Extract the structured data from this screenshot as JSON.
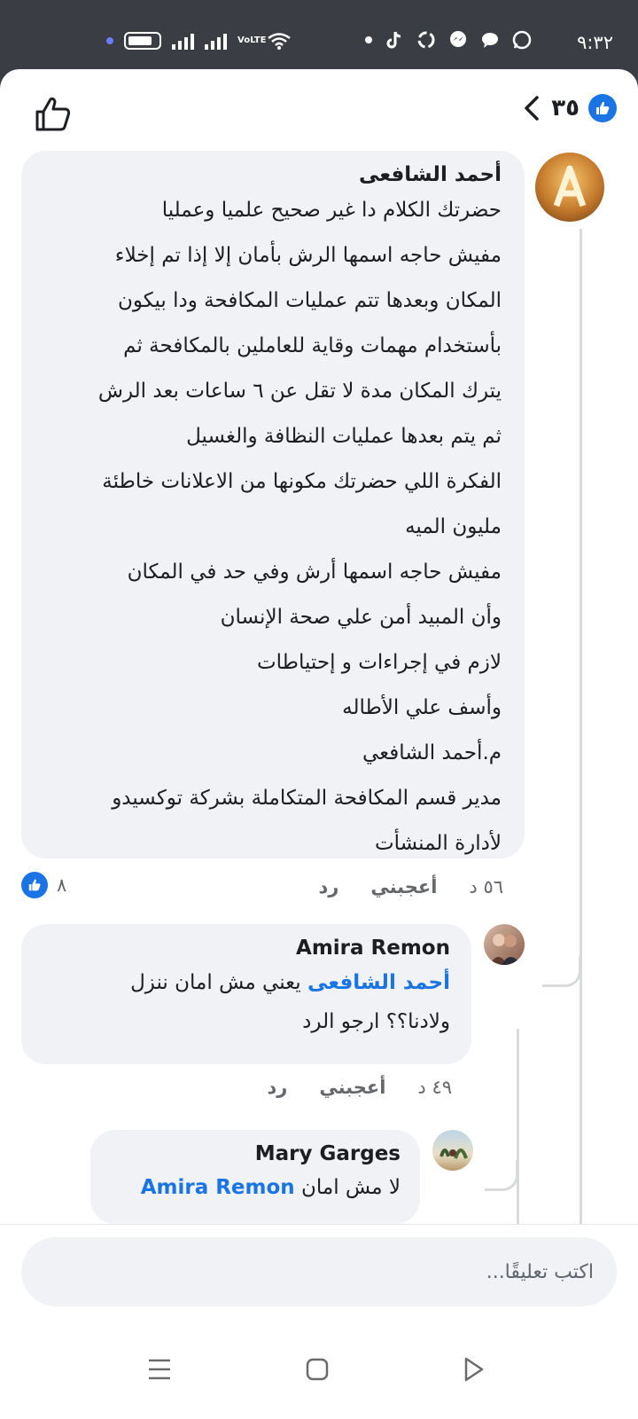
{
  "status": {
    "time": "٩:٣٢",
    "network": "VoLTE"
  },
  "header": {
    "reaction_count": "٣٥"
  },
  "comments": [
    {
      "author": "أحمد الشافعى",
      "text": "حضرتك الكلام دا غير صحيح علميا وعمليا\nمفيش حاجه اسمها الرش بأمان إلا إذا تم إخلاء\nالمكان وبعدها تتم عمليات المكافحة ودا بيكون\nبأستخدام مهمات وقاية للعاملين بالمكافحة ثم\nيترك المكان مدة لا تقل عن ٦ ساعات بعد الرش\nثم يتم بعدها عمليات النظافة والغسيل\nالفكرة اللي حضرتك مكونها من الاعلانات خاطئة\nمليون الميه\nمفيش حاجه اسمها أرش وفي حد في المكان\nوأن المبيد أمن علي صحة الإنسان\nلازم في إجراءات و إحتياطات\nوأسف علي الأطاله\nم.أحمد الشافعي\nمدير قسم المكافحة المتكاملة بشركة توكسيدو\nلأدارة المنشأت",
      "time": "٥٦ د",
      "like_label": "أعجبني",
      "reply_label": "رد",
      "likes": "٨"
    },
    {
      "author": "Amira Remon",
      "mention": "أحمد الشافعى",
      "text_line1": " يعني مش امان ننزل",
      "text_line2": "ولادنا؟؟ ارجو الرد",
      "time": "٤٩ د",
      "like_label": "أعجبني",
      "reply_label": "رد"
    },
    {
      "author": "Mary Garges",
      "text": "لا مش امان ",
      "mention": "Amira Remon"
    }
  ],
  "composer": {
    "placeholder": "اكتب تعليقًا..."
  },
  "colors": {
    "accent": "#1b74e4",
    "bubble": "#f0f2f5",
    "status_bar": "#3b3d45"
  }
}
